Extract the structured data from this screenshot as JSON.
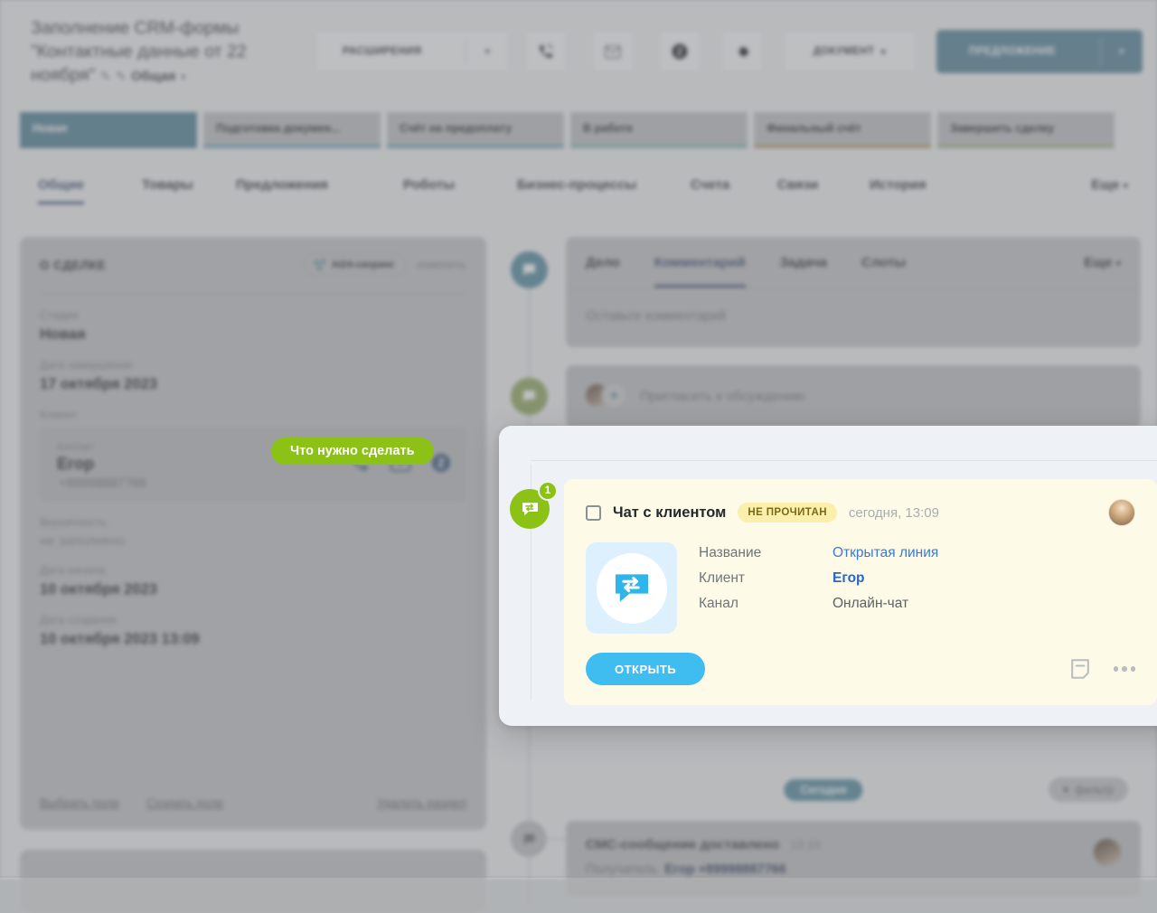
{
  "header": {
    "deal_title_line1": "Заполнение CRM-формы",
    "deal_title_line2": "\"Контактные данные от 22",
    "deal_title_line3": "ноября\"",
    "category_label": "Общая",
    "extensions_button": "РАСШИРЕНИЯ",
    "document_button": "ДОКУМЕНТ",
    "primary_button": "ПРЕДЛОЖЕНИЕ",
    "icons": [
      "phone-icon",
      "email-icon",
      "contact-icon",
      "gear-icon"
    ]
  },
  "stages": [
    {
      "label": "Новая",
      "active": true,
      "color": "#2b9fcc"
    },
    {
      "label": "Подготовка докумен...",
      "active": false,
      "color": "#3fbdf0"
    },
    {
      "label": "Счёт на предоплату",
      "active": false,
      "color": "#39c0e8"
    },
    {
      "label": "В работе",
      "active": false,
      "color": "#5ecfc0"
    },
    {
      "label": "Финальный счёт",
      "active": false,
      "color": "#d8a82f"
    },
    {
      "label": "Завершить сделку",
      "active": false,
      "color": "#97cc5a"
    }
  ],
  "nav_tabs": [
    {
      "label": "Общие",
      "active": true
    },
    {
      "label": "Товары",
      "active": false
    },
    {
      "label": "Предложения",
      "active": false
    },
    {
      "label": "Роботы",
      "active": false
    },
    {
      "label": "Бизнес-процессы",
      "active": false
    },
    {
      "label": "Счета",
      "active": false
    },
    {
      "label": "Связи",
      "active": false
    },
    {
      "label": "История",
      "active": false
    }
  ],
  "nav_more": "Еще",
  "left_panel": {
    "title": "О СДЕЛКЕ",
    "ai_chip": "AI24-скоринг",
    "edit_link": "изменить",
    "fields": [
      {
        "label": "Стадия",
        "value": "Новая"
      },
      {
        "label": "Дата завершения",
        "value": "17 октября 2023"
      }
    ],
    "client_label": "Клиент",
    "contact": {
      "label": "Контакт",
      "name": "Егор",
      "phone": "+89998887766"
    },
    "fields2": [
      {
        "label": "Вероятность",
        "value": "не заполнено"
      },
      {
        "label": "Дата начала",
        "value": "10 октября 2023"
      },
      {
        "label": "Дата создания",
        "value": "10 октября 2023 13:09"
      }
    ],
    "links": {
      "select_field": "Выбрать поле",
      "create_field": "Создать поле",
      "delete_section": "Удалить раздел"
    }
  },
  "composer": {
    "tabs": [
      {
        "label": "Дело",
        "active": false
      },
      {
        "label": "Комментарий",
        "active": true
      },
      {
        "label": "Задача",
        "active": false
      },
      {
        "label": "Слоты",
        "active": false
      }
    ],
    "more": "Еще",
    "placeholder": "Оставьте комментарий"
  },
  "invite": {
    "text": "Пригласить к обсуждению"
  },
  "timeline": {
    "today_pill": "Сегодня",
    "filter": "фильтр",
    "sms": {
      "title": "СМС-сообщение доставлено",
      "time": "13:10",
      "recipient_label": "Получатель",
      "recipient_name": "Егор",
      "recipient_phone": "+89998887766"
    }
  },
  "modal": {
    "need_pill": "Что нужно сделать",
    "badge_count": "1",
    "task": {
      "title": "Чат с клиентом",
      "tag": "НЕ ПРОЧИТАН",
      "time": "сегодня, 13:09",
      "fields": [
        {
          "label": "Название",
          "value": "Открытая линия",
          "style": "link"
        },
        {
          "label": "Клиент",
          "value": "Егор",
          "style": "bold"
        },
        {
          "label": "Канал",
          "value": "Онлайн-чат",
          "style": "plain"
        }
      ],
      "open_button": "ОТКРЫТЬ"
    }
  },
  "colors": {
    "accent_blue": "#2b9fcc",
    "button_blue": "#3fbdf0",
    "green": "#8cc215",
    "card_yellow": "#fdfbe8",
    "tag_yellow": "#fbf0ab",
    "link_blue": "#3b7ad0"
  }
}
